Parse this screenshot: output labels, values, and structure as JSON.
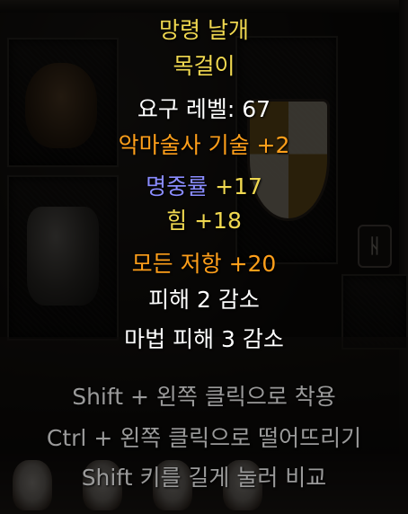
{
  "tooltip": {
    "item_name": "망령 날개",
    "item_type": "목걸이",
    "requirement": "요구 레벨: 67",
    "affixes": {
      "skill": "악마술사 기술 +2",
      "attack_rating_label": "명중률",
      "attack_rating_value": " +17",
      "strength": "힘 +18",
      "all_resist": "모든 저항 +20",
      "damage_reduce": "피해 2 감소",
      "magic_damage_reduce": "마법 피해 3 감소"
    },
    "hints": [
      "Shift + 왼쪽 클릭으로 착용",
      "Ctrl + 왼쪽 클릭으로 떨어뜨리기",
      "Shift 키를 길게 눌러 비교"
    ]
  },
  "background": {
    "rune_glyph": "ᚺ"
  },
  "colors": {
    "unique_yellow": "#f0d850",
    "white": "#ffffff",
    "skill_orange": "#ff9f1a",
    "magic_blue": "#8a8cff",
    "hint_gray": "#9a9a9a"
  }
}
